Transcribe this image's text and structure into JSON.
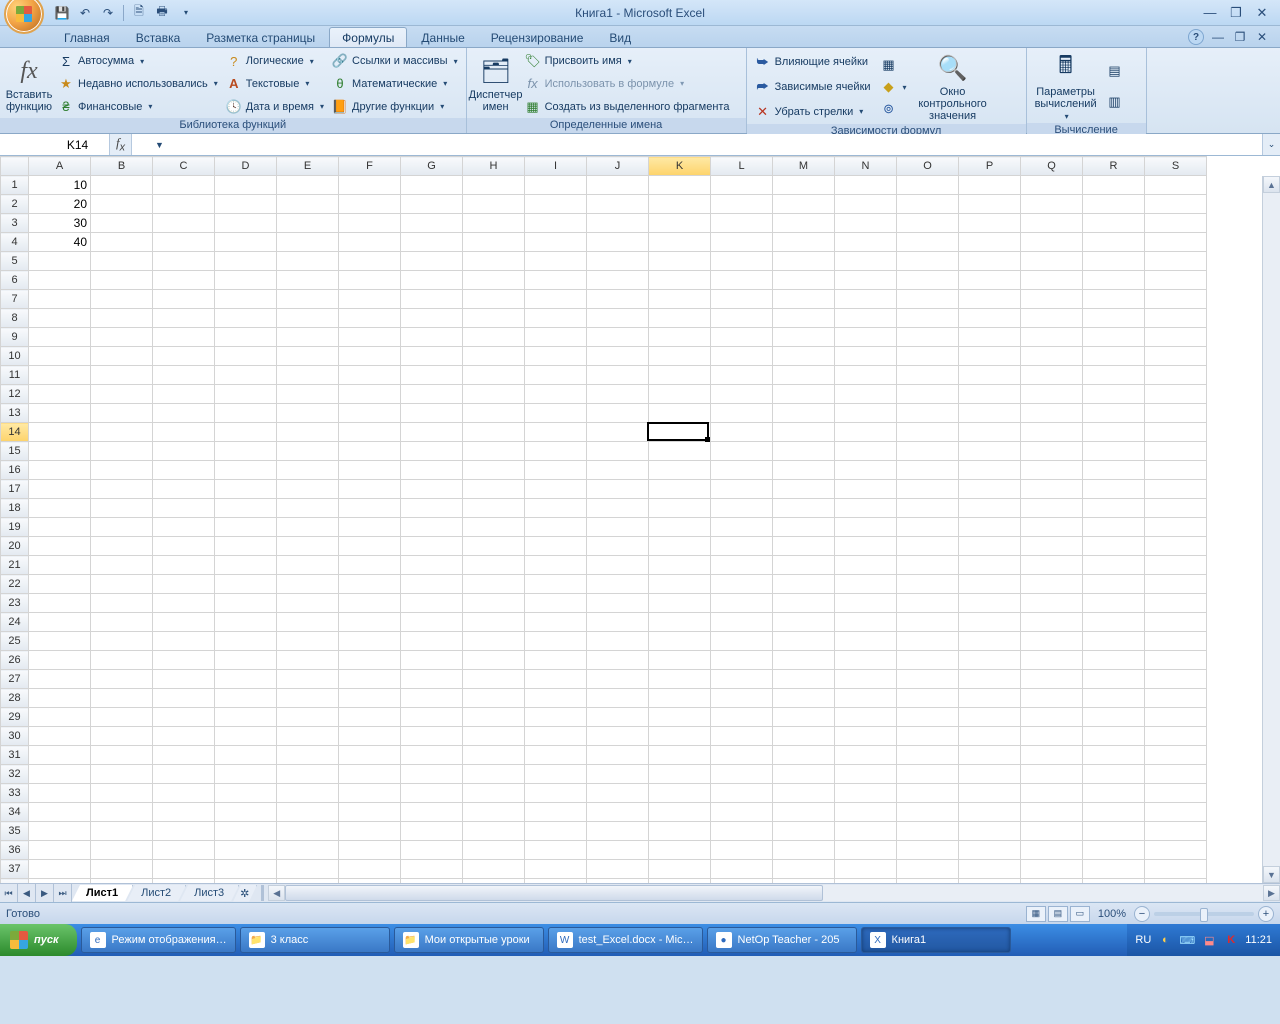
{
  "title": "Книга1 - Microsoft Excel",
  "tabs": [
    "Главная",
    "Вставка",
    "Разметка страницы",
    "Формулы",
    "Данные",
    "Рецензирование",
    "Вид"
  ],
  "active_tab_index": 3,
  "ribbon": {
    "g0": {
      "label": "Библиотека функций",
      "insert_fn": "Вставить функцию",
      "autosum": "Автосумма",
      "recent": "Недавно использовались",
      "financial": "Финансовые",
      "logical": "Логические",
      "text": "Текстовые",
      "date": "Дата и время",
      "lookup": "Ссылки и массивы",
      "math": "Математические",
      "more": "Другие функции"
    },
    "g1": {
      "label": "Определенные имена",
      "name_mgr": "Диспетчер имен",
      "define": "Присвоить имя",
      "use": "Использовать в формуле",
      "create": "Создать из выделенного фрагмента"
    },
    "g2": {
      "label": "Зависимости формул",
      "precedents": "Влияющие ячейки",
      "dependents": "Зависимые ячейки",
      "remove": "Убрать стрелки",
      "watch": "Окно контрольного значения"
    },
    "g3": {
      "label": "Вычисление",
      "options": "Параметры вычислений"
    }
  },
  "namebox": "K14",
  "formula": "",
  "columns": [
    "A",
    "B",
    "C",
    "D",
    "E",
    "F",
    "G",
    "H",
    "I",
    "J",
    "K",
    "L",
    "M",
    "N",
    "O",
    "P",
    "Q",
    "R",
    "S"
  ],
  "sel_col": "K",
  "sel_row": 14,
  "row_count": 38,
  "cells": {
    "A1": "10",
    "A2": "20",
    "A3": "30",
    "A4": "40"
  },
  "sheets": [
    "Лист1",
    "Лист2",
    "Лист3"
  ],
  "active_sheet": 0,
  "status": "Готово",
  "zoom": "100%",
  "taskbar": {
    "start": "пуск",
    "items": [
      {
        "label": "Режим отображения…",
        "icon": "e"
      },
      {
        "label": "3 класс",
        "icon": "📁"
      },
      {
        "label": "Мои открытые уроки",
        "icon": "📁"
      },
      {
        "label": "test_Excel.docx - Mic…",
        "icon": "W"
      },
      {
        "label": "NetOp Teacher - 205",
        "icon": "●"
      },
      {
        "label": "Книга1",
        "icon": "X",
        "active": true
      }
    ],
    "lang": "RU",
    "clock": "11:21"
  }
}
